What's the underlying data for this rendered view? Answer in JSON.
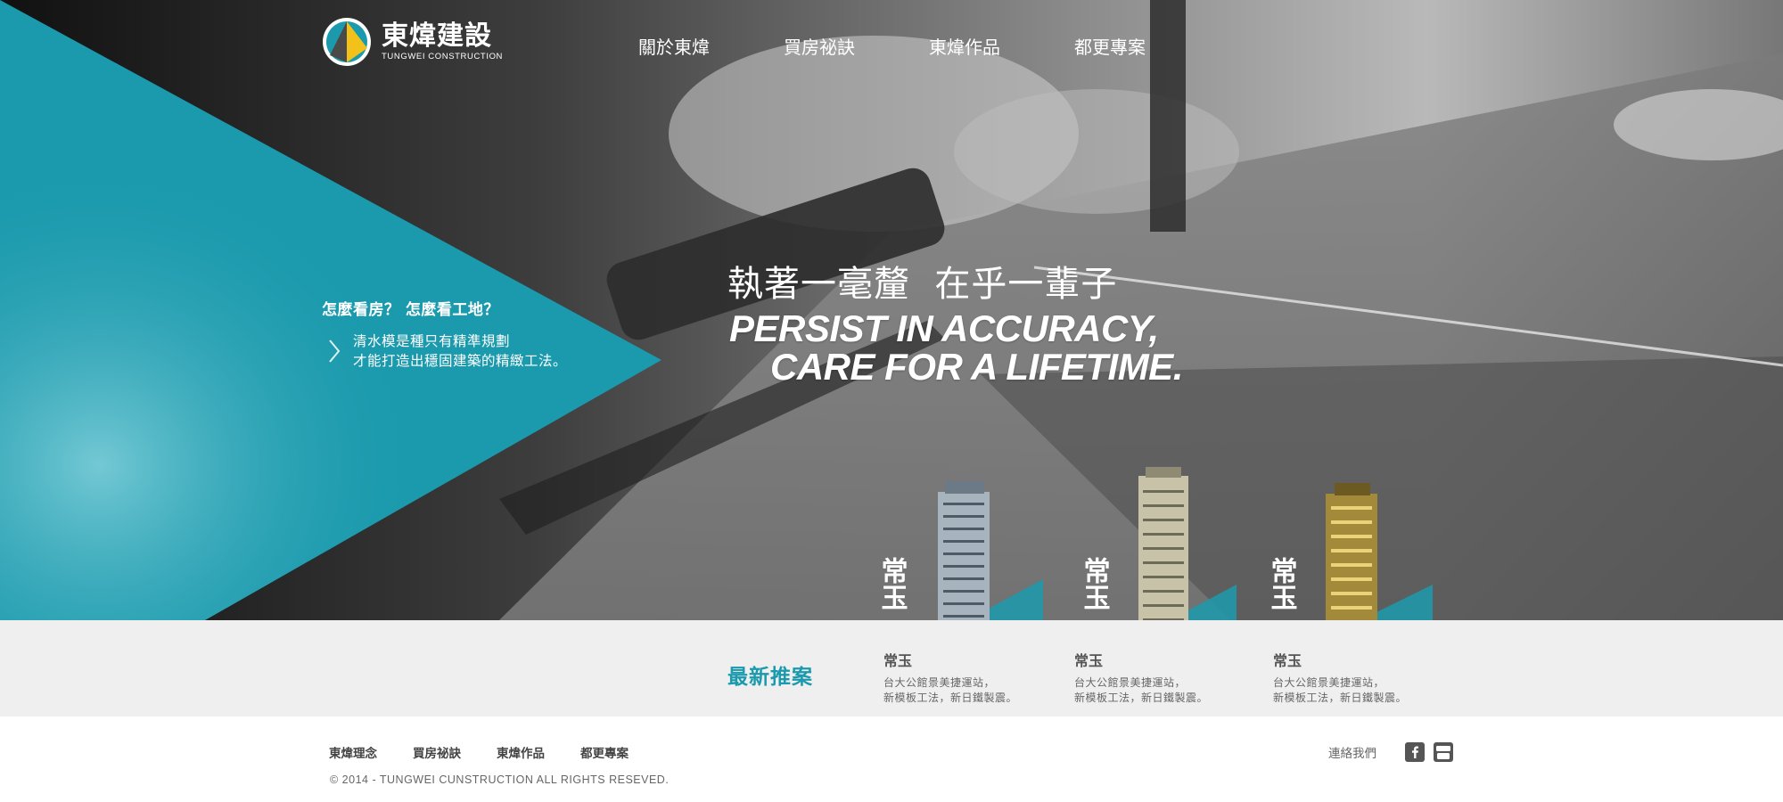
{
  "brand": {
    "name_cn": "東煒建設",
    "name_en": "TUNGWEI CONSTRUCTION"
  },
  "top_nav": [
    {
      "label": "關於東煒"
    },
    {
      "label": "買房祕訣"
    },
    {
      "label": "東煒作品"
    },
    {
      "label": "都更專案"
    }
  ],
  "hero": {
    "question": "怎麼看房？ 怎麼看工地？",
    "text_line1": "清水模是種只有精準規劃",
    "text_line2": "才能打造出穩固建築的精緻工法。",
    "headline_cn": "執著一毫釐  在乎一輩子",
    "headline_en_line1": "PERSIST IN ACCURACY,",
    "headline_en_line2": "CARE FOR A LIFETIME."
  },
  "latest": {
    "title": "最新推案",
    "projects": [
      {
        "logo_text": "常玉",
        "name": "常玉",
        "desc_line1": "台大公館景美捷運站，",
        "desc_line2": "新模板工法，新日鐵製震。"
      },
      {
        "logo_text": "常玉",
        "name": "常玉",
        "desc_line1": "台大公館景美捷運站，",
        "desc_line2": "新模板工法，新日鐵製震。"
      },
      {
        "logo_text": "常玉",
        "name": "常玉",
        "desc_line1": "台大公館景美捷運站，",
        "desc_line2": "新模板工法，新日鐵製震。"
      }
    ]
  },
  "footer": {
    "nav": [
      {
        "label": "東煒理念"
      },
      {
        "label": "買房祕訣"
      },
      {
        "label": "東煒作品"
      },
      {
        "label": "都更專案"
      }
    ],
    "copyright": "© 2014 - TUNGWEI CUNSTRUCTION ALL RIGHTS RESEVED.",
    "contact": "連絡我們",
    "social": [
      "facebook-icon",
      "youtube-icon"
    ]
  },
  "colors": {
    "accent_teal": "#1b9aad",
    "band_gray": "#efefef",
    "logo_yellow": "#f3c21a"
  }
}
